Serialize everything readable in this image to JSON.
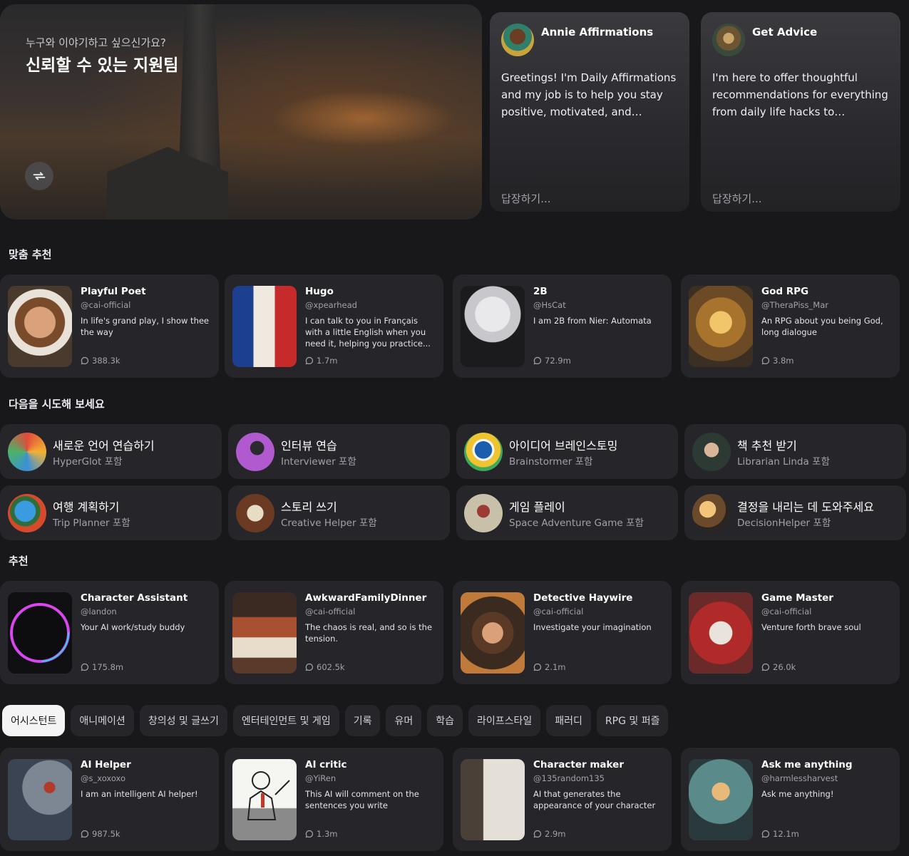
{
  "hero": {
    "subtitle": "누구와 이야기하고 싶으신가요?",
    "title": "신뢰할 수 있는 지원팀",
    "cards": [
      {
        "name": "Annie Affirmations",
        "message": "Greetings! I'm Daily Affirmations and my job is to help you stay positive, motivated, and inspired...",
        "reply": "답장하기..."
      },
      {
        "name": "Get Advice",
        "message": "I'm here to offer thoughtful recommendations for everything from daily life hacks to complex...",
        "reply": "답장하기..."
      }
    ]
  },
  "sections": {
    "for_you": "맞춤 추천",
    "try_these": "다음을 시도해 보세요",
    "featured": "추천"
  },
  "for_you": [
    {
      "name": "Playful Poet",
      "handle": "@cai-official",
      "desc": "In life's grand play, I show thee the way",
      "count": "388.3k"
    },
    {
      "name": "Hugo",
      "handle": "@xpearhead",
      "desc": "I can talk to you in Français with a little English when you need it, helping you practice...",
      "count": "1.7m"
    },
    {
      "name": "2B",
      "handle": "@HsCat",
      "desc": "I am 2B from Nier: Automata",
      "count": "72.9m"
    },
    {
      "name": "God RPG",
      "handle": "@TheraPiss_Mar",
      "desc": "An RPG about you being God, long dialogue",
      "count": "3.8m"
    }
  ],
  "try_these": [
    {
      "title": "새로운 언어 연습하기",
      "sub": "HyperGlot 포함"
    },
    {
      "title": "인터뷰 연습",
      "sub": "Interviewer 포함"
    },
    {
      "title": "아이디어 브레인스토밍",
      "sub": "Brainstormer 포함"
    },
    {
      "title": "책 추천 받기",
      "sub": "Librarian Linda 포함"
    },
    {
      "title": "여행 계획하기",
      "sub": "Trip Planner 포함"
    },
    {
      "title": "스토리 쓰기",
      "sub": "Creative Helper 포함"
    },
    {
      "title": "게임 플레이",
      "sub": "Space Adventure Game 포함"
    },
    {
      "title": "결정을 내리는 데 도와주세요",
      "sub": "DecisionHelper 포함"
    }
  ],
  "featured": [
    {
      "name": "Character Assistant",
      "handle": "@landon",
      "desc": "Your AI work/study buddy",
      "count": "175.8m"
    },
    {
      "name": "AwkwardFamilyDinner",
      "handle": "@cai-official",
      "desc": "The chaos is real, and so is the tension.",
      "count": "602.5k"
    },
    {
      "name": "Detective Haywire",
      "handle": "@cai-official",
      "desc": "Investigate your imagination",
      "count": "2.1m"
    },
    {
      "name": "Game Master",
      "handle": "@cai-official",
      "desc": "Venture forth brave soul",
      "count": "26.0k"
    }
  ],
  "tabs": [
    "어시스턴트",
    "애니메이션",
    "창의성 및 글쓰기",
    "엔터테인먼트 및 게임",
    "기록",
    "유머",
    "학습",
    "라이프스타일",
    "패러디",
    "RPG 및 퍼즐"
  ],
  "category": [
    {
      "name": "AI Helper",
      "handle": "@s_xoxoxo",
      "desc": "I am an intelligent AI helper!",
      "count": "987.5k"
    },
    {
      "name": "AI critic",
      "handle": "@YiRen",
      "desc": "This AI will comment on the sentences you write",
      "count": "1.3m"
    },
    {
      "name": "Character maker",
      "handle": "@135random135",
      "desc": "AI that generates the appearance of your character",
      "count": "2.9m"
    },
    {
      "name": "Ask me anything",
      "handle": "@harmlessharvest",
      "desc": "Ask me anything!",
      "count": "12.1m"
    }
  ]
}
